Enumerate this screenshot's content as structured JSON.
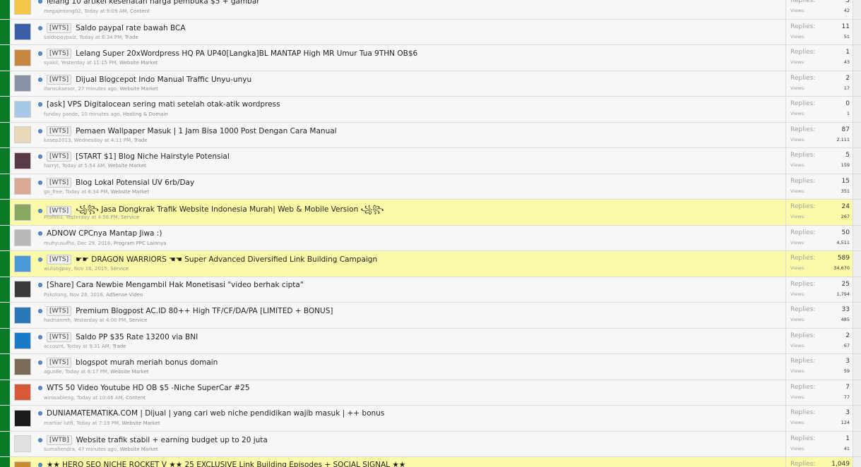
{
  "labels": {
    "replies": "Replies:",
    "views": "Views:"
  },
  "threads": [
    {
      "prefix": "",
      "title": "lelang 10 artikel kesehatan harga pembuka $5 + gambar",
      "author": "megajenong02",
      "date": "Today at 9:09 AM",
      "forum": "Content",
      "replies": "3",
      "views": "42",
      "sticky": false,
      "avatar": "#f3c64a"
    },
    {
      "prefix": "[WTS]",
      "title": "Saldo paypal rate bawah BCA",
      "author": "saldopaypalz",
      "date": "Today at 6:34 PM",
      "forum": "Trade",
      "replies": "11",
      "views": "51",
      "sticky": false,
      "avatar": "#3a5fa8"
    },
    {
      "prefix": "[WTS]",
      "title": "Lelang Super 20xWordpress HQ PA UP40[Langka]BL MANTAP High MR Umur Tua 9THN OB$6",
      "author": "syakil",
      "date": "Yesterday at 11:15 PM",
      "forum": "Website Market",
      "replies": "1",
      "views": "43",
      "sticky": false,
      "avatar": "#c8873e"
    },
    {
      "prefix": "[WTS]",
      "title": "Dijual Blogcepot Indo Manual Traffic Unyu-unyu",
      "author": "ifansuksesor",
      "date": "27 minutes ago",
      "forum": "Website Market",
      "replies": "2",
      "views": "17",
      "sticky": false,
      "avatar": "#8a94a8"
    },
    {
      "prefix": "",
      "title": "[ask] VPS Digitalocean sering mati setelah otak-atik wordpress",
      "author": "funday pande",
      "date": "10 minutes ago",
      "forum": "Hosting & Domain",
      "replies": "0",
      "views": "1",
      "sticky": false,
      "avatar": "#a8c8e8"
    },
    {
      "prefix": "[WTS]",
      "title": "Pemaen Wallpaper Masuk | 1 Jam Bisa 1000 Post Dengan Cara Manual",
      "author": "kasep2013",
      "date": "Wednesday at 4:11 PM",
      "forum": "Trade",
      "replies": "87",
      "views": "2,111",
      "sticky": false,
      "avatar": "#e8d8b8"
    },
    {
      "prefix": "[WTS]",
      "title": "[START $1] Blog Niche Hairstyle Potensial",
      "author": "harryt",
      "date": "Today at 5:54 AM",
      "forum": "Website Market",
      "replies": "5",
      "views": "159",
      "sticky": false,
      "avatar": "#5a3a48"
    },
    {
      "prefix": "[WTS]",
      "title": "Blog Lokal Potensial UV 6rb/Day",
      "author": "go_free",
      "date": "Today at 6:34 PM",
      "forum": "Website Market",
      "replies": "15",
      "views": "351",
      "sticky": false,
      "avatar": "#d8a898"
    },
    {
      "prefix": "[WTS]",
      "title": "꧁꧂ Jasa Dongkrak Trafik Website Indonesia Murah| Web & Mobile Version ꧁꧂",
      "author": "Profitku",
      "date": "Yesterday at 4:56 PM",
      "forum": "Service",
      "replies": "24",
      "views": "267",
      "sticky": true,
      "avatar": "#8aa860"
    },
    {
      "prefix": "",
      "title": "ADNOW CPCnya Mantap Jiwa :)",
      "author": "muhyusufhs",
      "date": "Dec 29, 2016",
      "forum": "Program PPC Lainnya",
      "replies": "50",
      "views": "4,511",
      "sticky": false,
      "avatar": "#b8b8b8"
    },
    {
      "prefix": "[WTS]",
      "title": "☛☛ DRAGON WARRIORS ☚☚ Super Advanced Diversified Link Building Campaign",
      "author": "wulungpay",
      "date": "Nov 18, 2015",
      "forum": "Service",
      "replies": "589",
      "views": "34,670",
      "sticky": true,
      "avatar": "#4a9ad8"
    },
    {
      "prefix": "",
      "title": "[Share] Cara Newbie Mengambil Hak Monetisasi \"video berhak cipta\"",
      "author": "Pakotong",
      "date": "Nov 28, 2016",
      "forum": "AdSense Video",
      "replies": "25",
      "views": "1,794",
      "sticky": false,
      "avatar": "#3a3a3a"
    },
    {
      "prefix": "[WTS]",
      "title": "Premium Blogpost AC.ID 80++ High TF/CF/DA/PA [LIMITED + BONUS]",
      "author": "hadrianmh",
      "date": "Yesterday at 4:00 PM",
      "forum": "Service",
      "replies": "33",
      "views": "485",
      "sticky": false,
      "avatar": "#2a78b8"
    },
    {
      "prefix": "[WTS]",
      "title": "Saldo PP $35 Rate 13200 via BNI",
      "author": "account",
      "date": "Today at 9:31 AM",
      "forum": "Trade",
      "replies": "2",
      "views": "67",
      "sticky": false,
      "avatar": "#1a7ac8"
    },
    {
      "prefix": "[WTS]",
      "title": "blogspot murah meriah bonus domain",
      "author": "agus8e",
      "date": "Today at 8:17 PM",
      "forum": "Website Market",
      "replies": "3",
      "views": "59",
      "sticky": false,
      "avatar": "#7a6a58"
    },
    {
      "prefix": "",
      "title": "WTS 50 Video Youtube HD OB $5 -Niche SuperCar #25",
      "author": "wirosableng",
      "date": "Today at 10:46 AM",
      "forum": "Content",
      "replies": "7",
      "views": "77",
      "sticky": false,
      "avatar": "#d8583a"
    },
    {
      "prefix": "",
      "title": "DUNIAMATEMATIKA.COM | Dijual | yang cari web niche pendidikan wajib masuk | ++ bonus",
      "author": "martiar lutfi",
      "date": "Today at 7:19 PM",
      "forum": "Website Market",
      "replies": "3",
      "views": "124",
      "sticky": false,
      "avatar": "#1a1a1a"
    },
    {
      "prefix": "[WTB]",
      "title": "Website trafik stabil + earning budget up to 20 juta",
      "author": "sumahendra",
      "date": "47 minutes ago",
      "forum": "Website Market",
      "replies": "1",
      "views": "41",
      "sticky": false,
      "avatar": "#e0e0e0"
    },
    {
      "prefix": "",
      "title": "★★ HERO SEO NICHE ROCKET V ★★ 25 EXCLUSIVE Link Building Episodes + SOCIAL SIGNAL ★★",
      "author": "",
      "date": "",
      "forum": "",
      "replies": "1,049",
      "views": "",
      "sticky": true,
      "avatar": "#c88a2a"
    }
  ]
}
